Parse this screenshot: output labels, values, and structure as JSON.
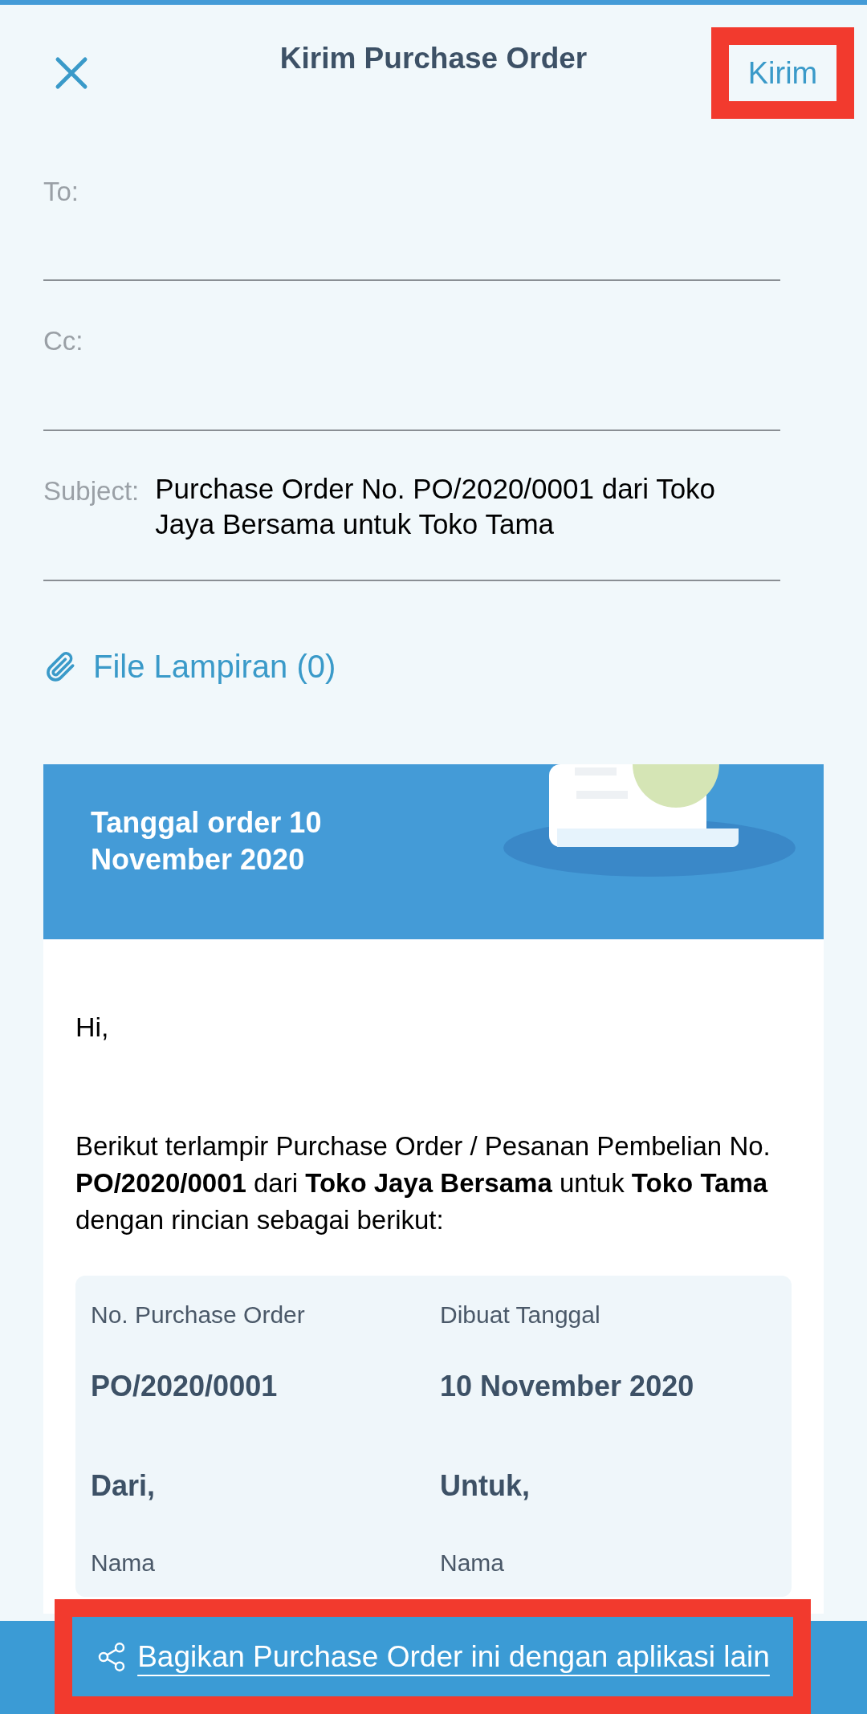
{
  "header": {
    "title": "Kirim Purchase Order",
    "send_button": {
      "label": "Kirim",
      "highlighted": true
    }
  },
  "fields": [
    {
      "label": "To:"
    },
    {
      "label": "Cc:"
    },
    {
      "label": "Subject:",
      "value": "Purchase Order No. PO/2020/0001 dari Toko Jaya Bersama untuk Toko Tama"
    }
  ],
  "attachments": {
    "label": "File Lampiran (0)"
  },
  "preview": {
    "order_date": "Tanggal order 10 November 2020",
    "greeting": "Hi,",
    "body": "Berikut terlampir Purchase Order / Pesanan Pembelian No. **PO/2020/0001** dari **Toko Jaya Bersama** untuk **Toko Tama** dengan rincian sebagai berikut:",
    "details": [
      {
        "label": "No. Purchase Order",
        "value": "PO/2020/0001"
      },
      {
        "label": "Dibuat Tanggal",
        "value": "10 November 2020"
      }
    ],
    "parties": [
      {
        "heading": "Dari,",
        "label": "Nama"
      },
      {
        "heading": "Untuk,",
        "label": "Nama"
      }
    ]
  },
  "share_button": {
    "label": "Bagikan Purchase Order ini dengan aplikasi lain",
    "highlighted": true
  }
}
